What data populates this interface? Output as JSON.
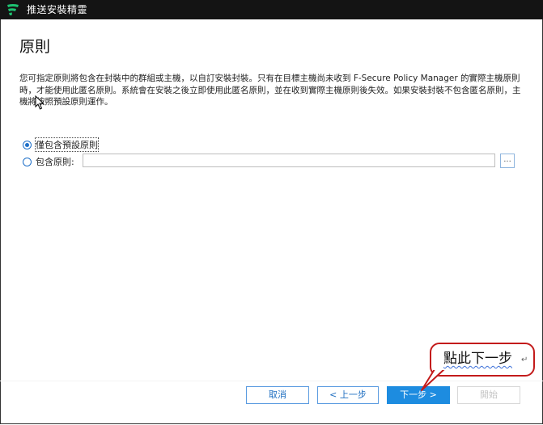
{
  "window": {
    "title": "推送安裝精靈",
    "brand_color": "#1ec271"
  },
  "page": {
    "title": "原則",
    "description": "您可指定原則將包含在封裝中的群組或主機，以自訂安裝封裝。只有在目標主機尚未收到 F-Secure Policy Manager 的實際主機原則時，才能使用此匿名原則。系統會在安裝之後立即使用此匿名原則，並在收到實際主機原則後失效。如果安裝封裝不包含匿名原則，主機將按照預設原則運作。"
  },
  "options": {
    "default_policy": {
      "label": "僅包含預設原則",
      "selected": true
    },
    "include_policy": {
      "label": "包含原則:",
      "selected": false,
      "value": ""
    },
    "browse_label": "..."
  },
  "buttons": {
    "cancel": "取消",
    "back": "< 上一步",
    "next": "下一步 >",
    "start": "開始"
  },
  "callout": {
    "text": "點此下一步",
    "mark": "↵",
    "color": "#c31b1b"
  },
  "colors": {
    "accent": "#1d8ce0",
    "titlebar": "#141414"
  }
}
